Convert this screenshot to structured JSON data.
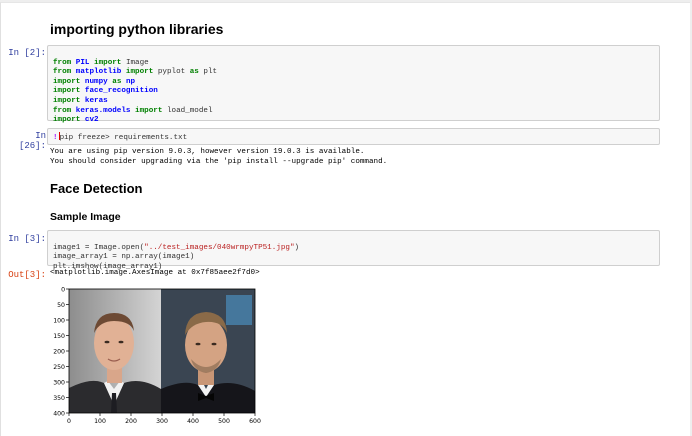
{
  "headings": {
    "importing": "importing python libraries",
    "face_detection": "Face Detection",
    "sample_image": "Sample Image"
  },
  "cell_imports": {
    "prompt": "In  [2]:",
    "lines": [
      {
        "a": "from ",
        "b": "PIL",
        "c": " import ",
        "d": "Image"
      },
      {
        "a": "from ",
        "b": "matplotlib",
        "c": " import ",
        "d": "pyplot",
        "e": " as ",
        "f": "plt"
      },
      {
        "a": "import ",
        "b": "numpy",
        "c": " as ",
        "d": "np"
      },
      {
        "a": "import ",
        "b": "face_recognition"
      },
      {
        "a": "import ",
        "b": "keras"
      },
      {
        "a": "from ",
        "b": "keras.models",
        "c": " import ",
        "d": "load_model"
      },
      {
        "a": "import ",
        "b": "cv2"
      }
    ]
  },
  "cell_pip": {
    "prompt": "In  [26]:",
    "code_rest": "pip freeze> requirements.txt",
    "output_lines": [
      "You are using pip version 9.0.3, however version 19.0.3 is available.",
      "You should consider upgrading via the 'pip install --upgrade pip' command."
    ]
  },
  "cell_image": {
    "prompt": "In  [3]:",
    "line1_pre": "image1 = Image.open(",
    "line1_str": "\"../test_images/040wrmpyTP51.jpg\"",
    "line1_post": ")",
    "line2": "image_array1 = np.array(image1)",
    "line3": "plt.imshow(image_array1)",
    "out_prompt": "Out[3]:",
    "output": "<matplotlib.image.AxesImage at 0x7f85aee2f7d0>"
  },
  "chart_data": {
    "type": "image",
    "xticks": [
      0,
      100,
      200,
      300,
      400,
      500,
      600
    ],
    "yticks": [
      0,
      50,
      100,
      150,
      200,
      250,
      300,
      350,
      400
    ],
    "xlim": [
      0,
      600
    ],
    "ylim": [
      400,
      0
    ]
  },
  "colors": {
    "in_prompt": "#303f9f",
    "out_prompt": "#d84315",
    "keyword": "#008000",
    "module": "#0000ff",
    "string": "#ba2121"
  }
}
